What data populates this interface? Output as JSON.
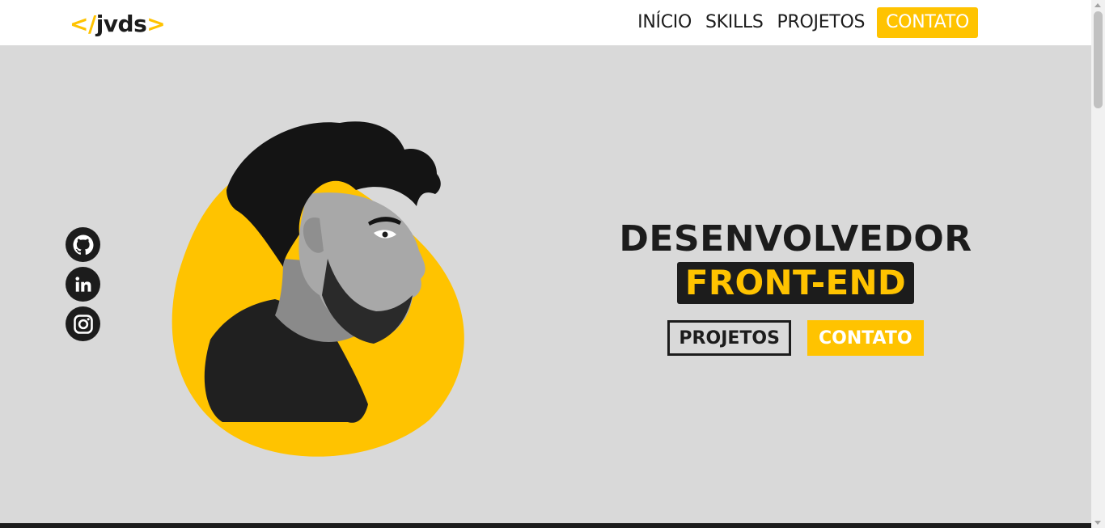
{
  "header": {
    "logo": {
      "open": "</",
      "name": "jvds",
      "close": ">"
    },
    "nav": [
      {
        "label": "INÍCIO"
      },
      {
        "label": "SKILLS"
      },
      {
        "label": "PROJETOS"
      },
      {
        "label": "CONTATO"
      }
    ]
  },
  "social": [
    "github-icon",
    "linkedin-icon",
    "instagram-icon"
  ],
  "hero": {
    "title": "DESENVOLVEDOR",
    "subtitle": "FRONT-END",
    "buttons": {
      "projects": "PROJETOS",
      "contact": "CONTATO"
    }
  },
  "colors": {
    "accent": "#ffc300",
    "dark": "#1c1c1c",
    "background": "#d9d9d9"
  }
}
